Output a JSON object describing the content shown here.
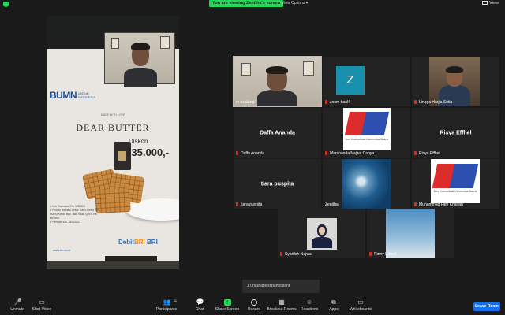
{
  "topbar": {
    "viewing_text": "You are viewing Zenitha's screen",
    "view_options": "View Options",
    "view_button": "View"
  },
  "shared_screen": {
    "logo": "BUMN",
    "logo_sub": "UNTUK INDONESIA",
    "brand_small": "MADE WITH LOVE",
    "brand": "DEAR BUTTER",
    "diskon": "Diskon",
    "price_prefix": "Rp",
    "price": "35.000,-",
    "terms": [
      "• Min Transaksi Rp 125.000",
      "• Promo Berlaku untuk Kartu Debit BRI,",
      "  Kartu Kredit BRI, dan Scan QRIS via BRImo",
      "• Periode s.d. Juli 2022"
    ],
    "debit_label": "Debit",
    "debit_bank": "BRI",
    "debit_bank2": "BRI",
    "website": "www.bri.co.id"
  },
  "participants": [
    {
      "name": "m rizalzzqi",
      "type": "video",
      "active": true
    },
    {
      "name": "zoom baal4",
      "type": "avatar",
      "initial": "Z"
    },
    {
      "name": "Lingga Harjia Setia",
      "type": "video"
    },
    {
      "name": "Daffa Ananda",
      "type": "name"
    },
    {
      "name": "Marshanda Najwa Cahya",
      "type": "logo"
    },
    {
      "name": "Risya Effhel",
      "type": "name"
    },
    {
      "name": "tiara puspita",
      "type": "name"
    },
    {
      "name": "Zenitha",
      "type": "sea"
    },
    {
      "name": "Muhammad Fikri Khairan",
      "type": "logo"
    },
    {
      "name": "Syarifah Najwa",
      "type": "photo"
    },
    {
      "name": "Rinny Efendi",
      "type": "sky"
    }
  ],
  "logo_caption": "Ilmu Komunikasi\nUniversitas Bakrie",
  "unassigned": "1 unassigned participant",
  "toolbar": {
    "unmute": "Unmute",
    "start_video": "Start Video",
    "participants": "Participants",
    "participants_count": "11",
    "chat": "Chat",
    "share_screen": "Share Screen",
    "record": "Record",
    "breakout": "Breakout Rooms",
    "reactions": "Reactions",
    "apps": "Apps",
    "whiteboards": "Whiteboards",
    "leave": "Leave Room"
  },
  "colors": {
    "share_green": "#23d959",
    "active_border": "#b5d84a",
    "leave_blue": "#1570ef",
    "mic_red": "#e02b2b"
  }
}
